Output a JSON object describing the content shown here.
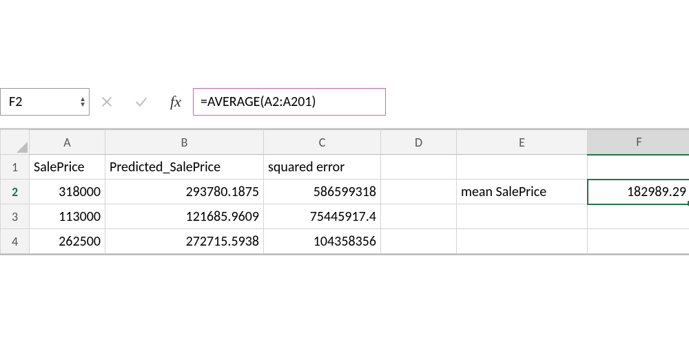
{
  "nameBox": "F2",
  "formulaBar": "=AVERAGE(A2:A201)",
  "columns": [
    "A",
    "B",
    "C",
    "D",
    "E",
    "F"
  ],
  "activeCell": {
    "row": 2,
    "col": "F"
  },
  "headers": {
    "A1": "SalePrice",
    "B1": "Predicted_SalePrice",
    "C1": "squared error"
  },
  "rows": [
    {
      "r": 1,
      "A": "SalePrice",
      "B": "Predicted_SalePrice",
      "C": "squared error",
      "D": "",
      "E": "",
      "F": ""
    },
    {
      "r": 2,
      "A": "318000",
      "B": "293780.1875",
      "C": "586599318",
      "D": "",
      "E": "mean SalePrice",
      "F": "182989.29"
    },
    {
      "r": 3,
      "A": "113000",
      "B": "121685.9609",
      "C": "75445917.4",
      "D": "",
      "E": "",
      "F": ""
    },
    {
      "r": 4,
      "A": "262500",
      "B": "272715.5938",
      "C": "104358356",
      "D": "",
      "E": "",
      "F": ""
    }
  ]
}
